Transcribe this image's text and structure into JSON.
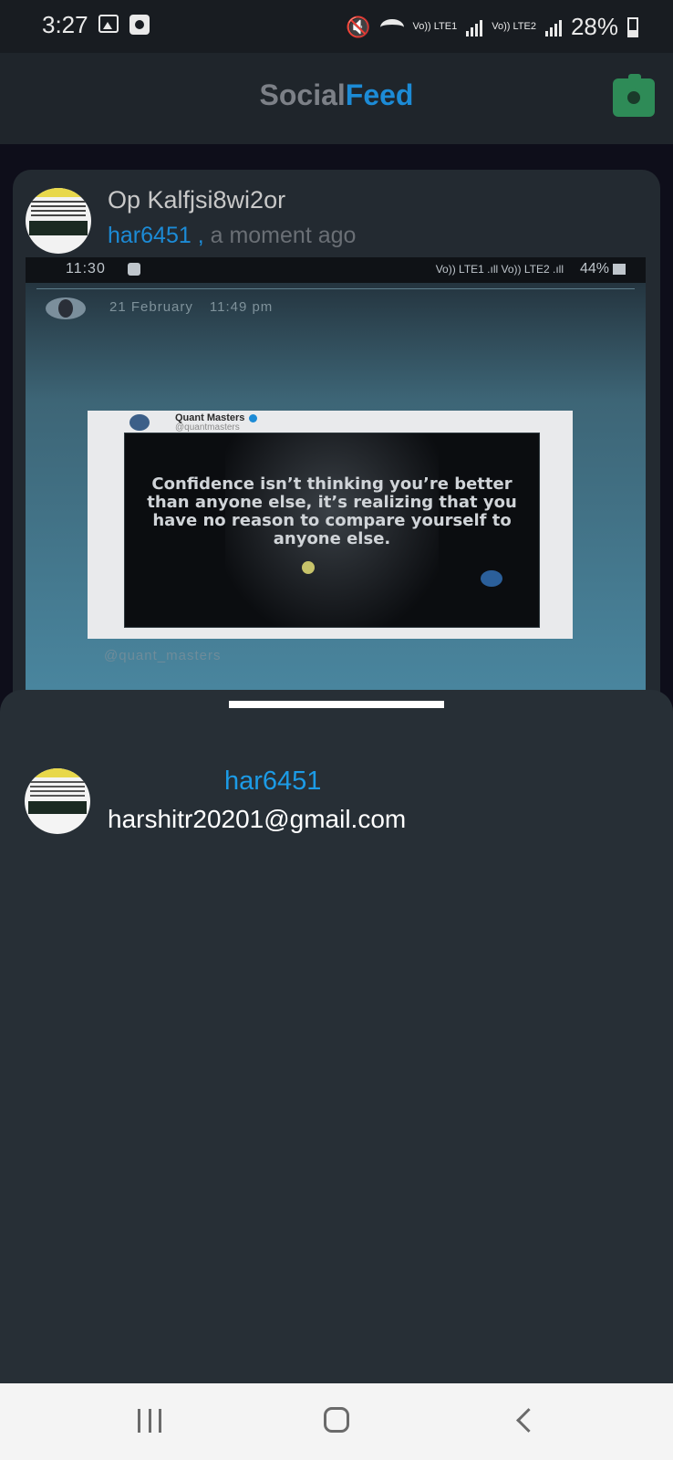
{
  "status_bar": {
    "time": "3:27",
    "sim1": "Vo)) LTE1",
    "sim2": "Vo)) LTE2",
    "battery": "28%"
  },
  "app_bar": {
    "title_part1": "Social",
    "title_part2": "Feed",
    "camera_icon": "camera-icon"
  },
  "post": {
    "title": "Op Kalfjsi8wi2or",
    "username": "har6451",
    "separator": " ,",
    "time": " a moment ago",
    "image": {
      "status_time": "11:30",
      "status_battery": "44%",
      "status_signal": "Vo)) LTE1 .ıll Vo)) LTE2 .ıll",
      "date": "21 February",
      "time": "11:49 pm",
      "quote_account": "Quant Masters",
      "quote_account_handle": "@quantmasters",
      "quote_text": "Confidence isn’t thinking you’re better than anyone else, it’s realizing that you have no reason to compare yourself to anyone else.",
      "footer_handle": "@quant_masters"
    }
  },
  "sheet": {
    "username": "har6451",
    "email": "harshitr20201@gmail.com"
  },
  "colors": {
    "accent": "#1c8bd6",
    "camera_button": "#2e8b57",
    "sheet_bg": "#272f36"
  }
}
